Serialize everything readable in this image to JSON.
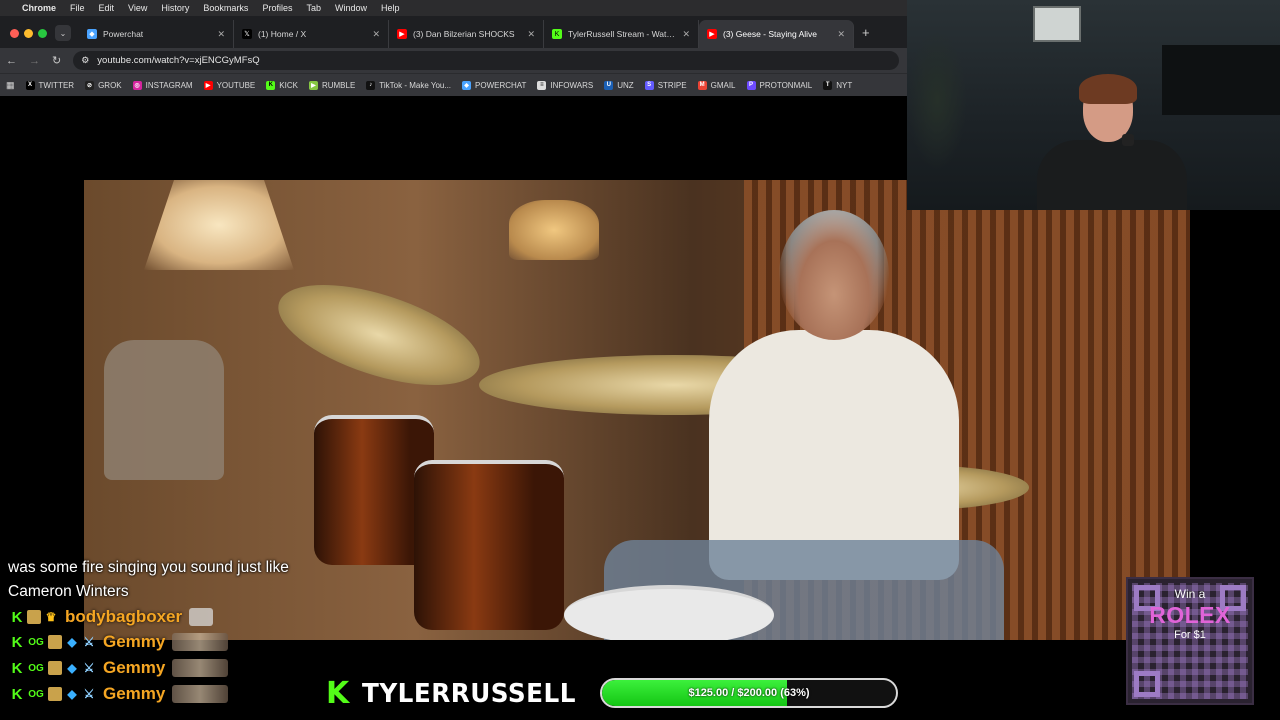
{
  "menubar": {
    "app": "Chrome",
    "items": [
      "File",
      "Edit",
      "View",
      "History",
      "Bookmarks",
      "Profiles",
      "Tab",
      "Window",
      "Help"
    ]
  },
  "tabs": [
    {
      "title": "Powerchat",
      "icon": "powerchat-icon",
      "color": "#4aa3ff"
    },
    {
      "title": "(1) Home / X",
      "icon": "x-icon",
      "color": "#000000"
    },
    {
      "title": "(3) Dan Bilzerian SHOCKS",
      "icon": "youtube-icon",
      "color": "#ff0000"
    },
    {
      "title": "TylerRussell Stream - Watch l",
      "icon": "kick-icon",
      "color": "#53fc18"
    },
    {
      "title": "(3) Geese - Staying Alive",
      "icon": "youtube-icon",
      "color": "#ff0000",
      "active": true
    }
  ],
  "address": {
    "url": "youtube.com/watch?v=xjENCGyMFsQ"
  },
  "bookmarks": [
    {
      "label": "TWITTER",
      "icon": "x-icon",
      "color": "#000000"
    },
    {
      "label": "GROK",
      "icon": "grok-icon",
      "color": "#222222"
    },
    {
      "label": "INSTAGRAM",
      "icon": "instagram-icon",
      "color": "#d6249f"
    },
    {
      "label": "YOUTUBE",
      "icon": "youtube-icon",
      "color": "#ff0000"
    },
    {
      "label": "KICK",
      "icon": "kick-icon",
      "color": "#53fc18"
    },
    {
      "label": "RUMBLE",
      "icon": "rumble-icon",
      "color": "#85c742"
    },
    {
      "label": "TikTok - Make You...",
      "icon": "tiktok-icon",
      "color": "#111111"
    },
    {
      "label": "POWERCHAT",
      "icon": "powerchat-icon",
      "color": "#4aa3ff"
    },
    {
      "label": "INFOWARS",
      "icon": "infowars-icon",
      "color": "#dddddd"
    },
    {
      "label": "UNZ",
      "icon": "unz-icon",
      "color": "#1a5fb4"
    },
    {
      "label": "STRIPE",
      "icon": "stripe-icon",
      "color": "#635bff"
    },
    {
      "label": "GMAIL",
      "icon": "gmail-icon",
      "color": "#ea4335"
    },
    {
      "label": "PROTONMAIL",
      "icon": "protonmail-icon",
      "color": "#6d4aff"
    },
    {
      "label": "NYT",
      "icon": "nyt-icon",
      "color": "#111111"
    }
  ],
  "chat": {
    "message": "was some fire singing you sound just like Cameron Winters",
    "rows": [
      {
        "username": "bodybagboxer",
        "color": "#f5a623"
      },
      {
        "username": "Gemmy",
        "color": "#f5a623"
      },
      {
        "username": "Gemmy",
        "color": "#f5a623"
      },
      {
        "username": "Gemmy",
        "color": "#f5a623"
      }
    ]
  },
  "stream": {
    "brand_name": "TYLERRUSSELL",
    "accent": "#53fc18"
  },
  "goal": {
    "label": "$125.00 / $200.00 (63%)",
    "fraction": 0.63
  },
  "promo": {
    "line1": "Win a",
    "line2": "ROLEX",
    "line3": "For $1"
  }
}
